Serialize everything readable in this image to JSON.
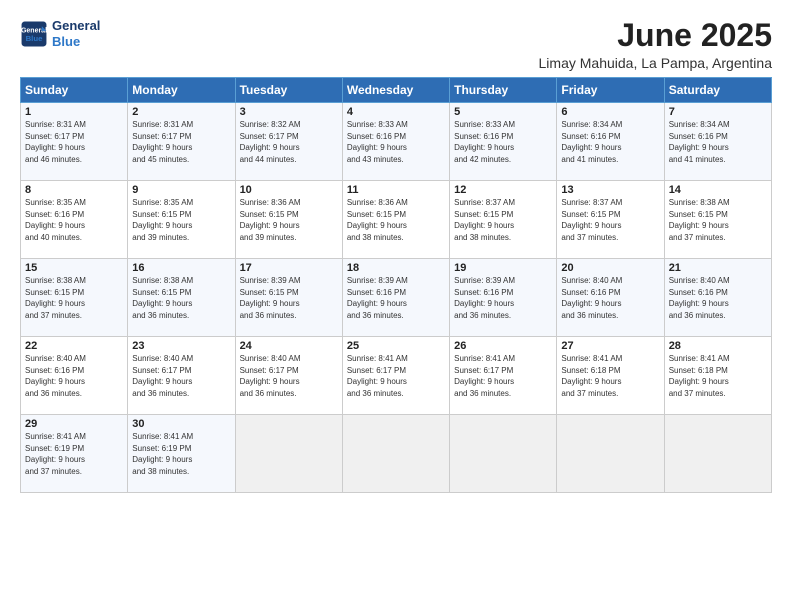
{
  "logo": {
    "line1": "General",
    "line2": "Blue"
  },
  "title": "June 2025",
  "subtitle": "Limay Mahuida, La Pampa, Argentina",
  "days_of_week": [
    "Sunday",
    "Monday",
    "Tuesday",
    "Wednesday",
    "Thursday",
    "Friday",
    "Saturday"
  ],
  "weeks": [
    [
      {
        "day": "1",
        "info": "Sunrise: 8:31 AM\nSunset: 6:17 PM\nDaylight: 9 hours\nand 46 minutes."
      },
      {
        "day": "2",
        "info": "Sunrise: 8:31 AM\nSunset: 6:17 PM\nDaylight: 9 hours\nand 45 minutes."
      },
      {
        "day": "3",
        "info": "Sunrise: 8:32 AM\nSunset: 6:17 PM\nDaylight: 9 hours\nand 44 minutes."
      },
      {
        "day": "4",
        "info": "Sunrise: 8:33 AM\nSunset: 6:16 PM\nDaylight: 9 hours\nand 43 minutes."
      },
      {
        "day": "5",
        "info": "Sunrise: 8:33 AM\nSunset: 6:16 PM\nDaylight: 9 hours\nand 42 minutes."
      },
      {
        "day": "6",
        "info": "Sunrise: 8:34 AM\nSunset: 6:16 PM\nDaylight: 9 hours\nand 41 minutes."
      },
      {
        "day": "7",
        "info": "Sunrise: 8:34 AM\nSunset: 6:16 PM\nDaylight: 9 hours\nand 41 minutes."
      }
    ],
    [
      {
        "day": "8",
        "info": "Sunrise: 8:35 AM\nSunset: 6:16 PM\nDaylight: 9 hours\nand 40 minutes."
      },
      {
        "day": "9",
        "info": "Sunrise: 8:35 AM\nSunset: 6:15 PM\nDaylight: 9 hours\nand 39 minutes."
      },
      {
        "day": "10",
        "info": "Sunrise: 8:36 AM\nSunset: 6:15 PM\nDaylight: 9 hours\nand 39 minutes."
      },
      {
        "day": "11",
        "info": "Sunrise: 8:36 AM\nSunset: 6:15 PM\nDaylight: 9 hours\nand 38 minutes."
      },
      {
        "day": "12",
        "info": "Sunrise: 8:37 AM\nSunset: 6:15 PM\nDaylight: 9 hours\nand 38 minutes."
      },
      {
        "day": "13",
        "info": "Sunrise: 8:37 AM\nSunset: 6:15 PM\nDaylight: 9 hours\nand 37 minutes."
      },
      {
        "day": "14",
        "info": "Sunrise: 8:38 AM\nSunset: 6:15 PM\nDaylight: 9 hours\nand 37 minutes."
      }
    ],
    [
      {
        "day": "15",
        "info": "Sunrise: 8:38 AM\nSunset: 6:15 PM\nDaylight: 9 hours\nand 37 minutes."
      },
      {
        "day": "16",
        "info": "Sunrise: 8:38 AM\nSunset: 6:15 PM\nDaylight: 9 hours\nand 36 minutes."
      },
      {
        "day": "17",
        "info": "Sunrise: 8:39 AM\nSunset: 6:15 PM\nDaylight: 9 hours\nand 36 minutes."
      },
      {
        "day": "18",
        "info": "Sunrise: 8:39 AM\nSunset: 6:16 PM\nDaylight: 9 hours\nand 36 minutes."
      },
      {
        "day": "19",
        "info": "Sunrise: 8:39 AM\nSunset: 6:16 PM\nDaylight: 9 hours\nand 36 minutes."
      },
      {
        "day": "20",
        "info": "Sunrise: 8:40 AM\nSunset: 6:16 PM\nDaylight: 9 hours\nand 36 minutes."
      },
      {
        "day": "21",
        "info": "Sunrise: 8:40 AM\nSunset: 6:16 PM\nDaylight: 9 hours\nand 36 minutes."
      }
    ],
    [
      {
        "day": "22",
        "info": "Sunrise: 8:40 AM\nSunset: 6:16 PM\nDaylight: 9 hours\nand 36 minutes."
      },
      {
        "day": "23",
        "info": "Sunrise: 8:40 AM\nSunset: 6:17 PM\nDaylight: 9 hours\nand 36 minutes."
      },
      {
        "day": "24",
        "info": "Sunrise: 8:40 AM\nSunset: 6:17 PM\nDaylight: 9 hours\nand 36 minutes."
      },
      {
        "day": "25",
        "info": "Sunrise: 8:41 AM\nSunset: 6:17 PM\nDaylight: 9 hours\nand 36 minutes."
      },
      {
        "day": "26",
        "info": "Sunrise: 8:41 AM\nSunset: 6:17 PM\nDaylight: 9 hours\nand 36 minutes."
      },
      {
        "day": "27",
        "info": "Sunrise: 8:41 AM\nSunset: 6:18 PM\nDaylight: 9 hours\nand 37 minutes."
      },
      {
        "day": "28",
        "info": "Sunrise: 8:41 AM\nSunset: 6:18 PM\nDaylight: 9 hours\nand 37 minutes."
      }
    ],
    [
      {
        "day": "29",
        "info": "Sunrise: 8:41 AM\nSunset: 6:19 PM\nDaylight: 9 hours\nand 37 minutes."
      },
      {
        "day": "30",
        "info": "Sunrise: 8:41 AM\nSunset: 6:19 PM\nDaylight: 9 hours\nand 38 minutes."
      },
      {
        "day": "",
        "info": ""
      },
      {
        "day": "",
        "info": ""
      },
      {
        "day": "",
        "info": ""
      },
      {
        "day": "",
        "info": ""
      },
      {
        "day": "",
        "info": ""
      }
    ]
  ]
}
